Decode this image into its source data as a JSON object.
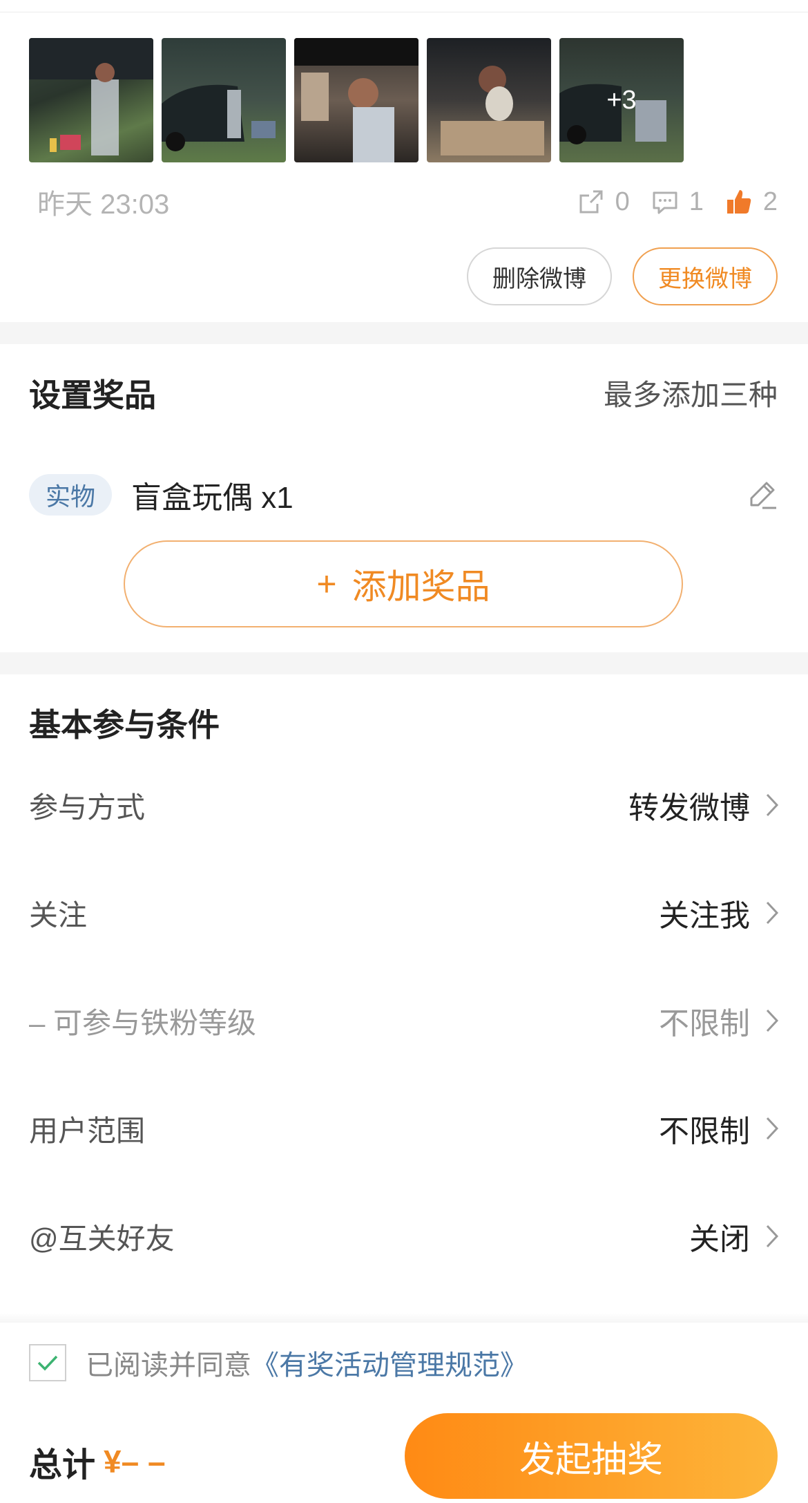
{
  "post": {
    "thumbnails": [
      {
        "name": "photo-1"
      },
      {
        "name": "photo-2"
      },
      {
        "name": "photo-3"
      },
      {
        "name": "photo-4"
      },
      {
        "name": "photo-5",
        "more_label": "+3"
      }
    ],
    "time": "昨天 23:03",
    "stats": {
      "share_count": "0",
      "comment_count": "1",
      "like_count": "2"
    },
    "delete_button": "删除微博",
    "change_button": "更换微博"
  },
  "prize_section": {
    "title": "设置奖品",
    "note": "最多添加三种",
    "items": [
      {
        "tag": "实物",
        "name": "盲盒玩偶 x1"
      }
    ],
    "add_button": {
      "plus": "+",
      "label": "添加奖品"
    }
  },
  "conditions": {
    "title": "基本参与条件",
    "rows": [
      {
        "label": "参与方式",
        "value": "转发微博"
      },
      {
        "label": "关注",
        "value": "关注我"
      },
      {
        "label": "– 可参与铁粉等级",
        "value": "不限制"
      },
      {
        "label": "用户范围",
        "value": "不限制"
      },
      {
        "label": "@互关好友",
        "value": "关闭"
      }
    ]
  },
  "footer": {
    "agree_text": "已阅读并同意",
    "agree_link": "《有奖活动管理规范》",
    "total_label": "总计",
    "total_value": "¥– –",
    "launch_button": "发起抽奖"
  },
  "colors": {
    "accent": "#f08a23",
    "link": "#4b78a6",
    "like": "#f07a2a"
  }
}
